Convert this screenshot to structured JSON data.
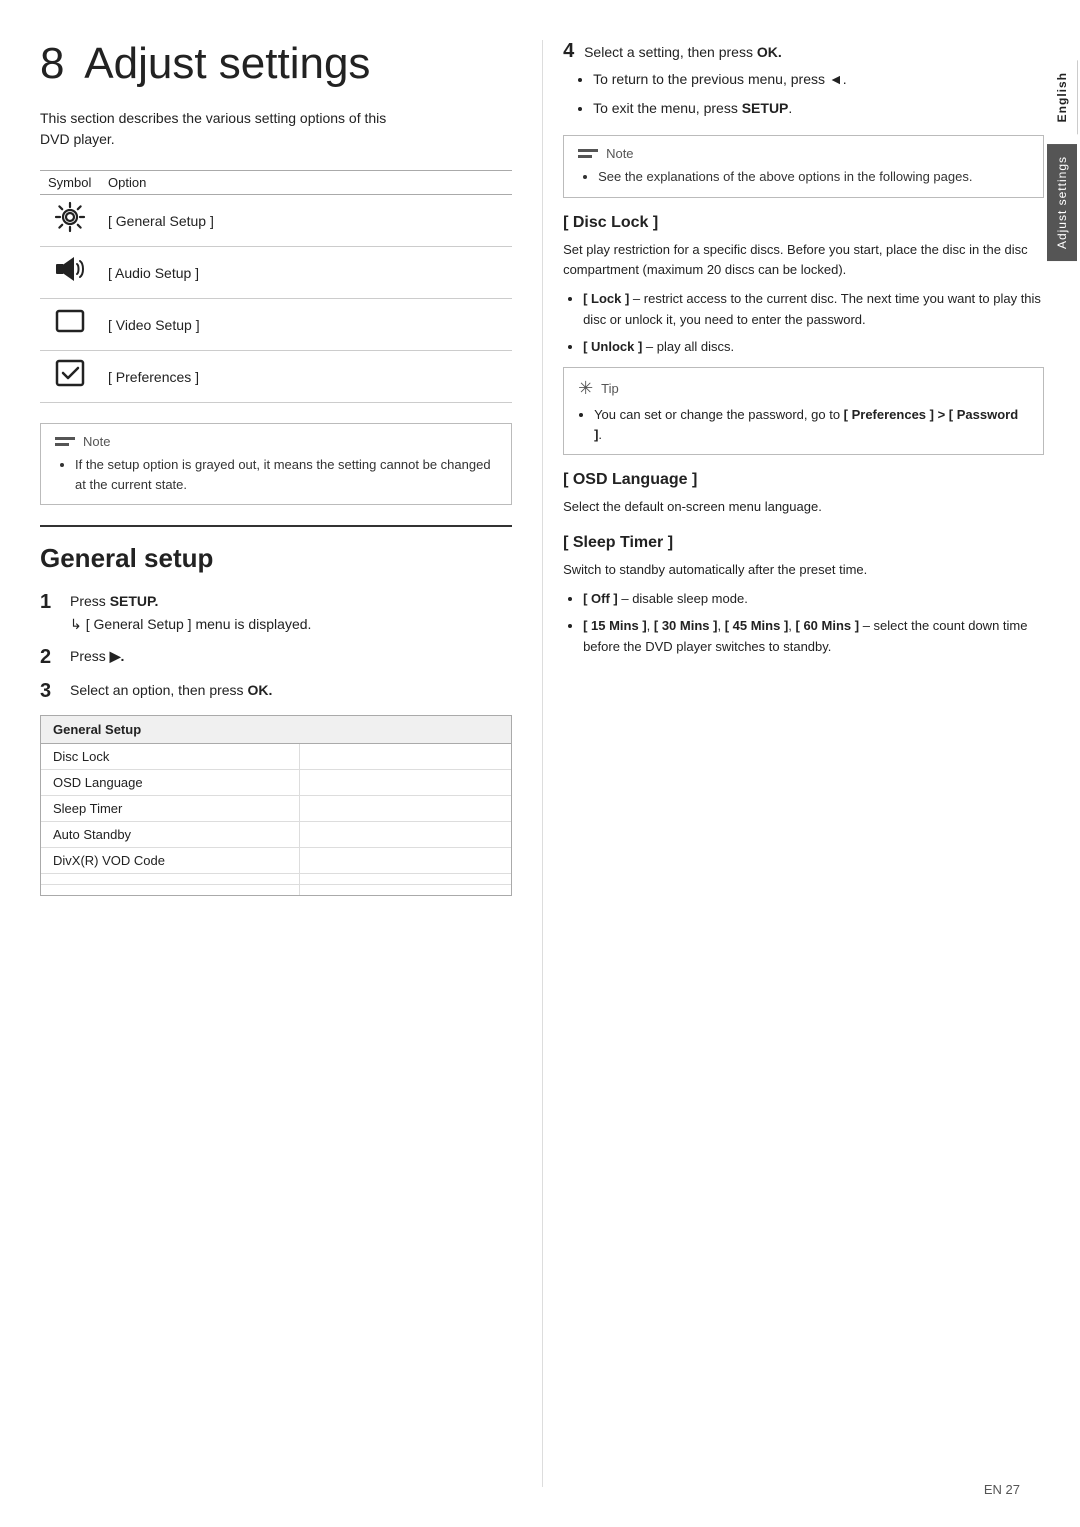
{
  "page": {
    "chapter_number": "8",
    "chapter_title": "Adjust settings",
    "intro_text": "This section describes the various setting options of this DVD player.",
    "symbol_table": {
      "col_symbol": "Symbol",
      "col_option": "Option",
      "rows": [
        {
          "symbol": "⚙",
          "option": "[ General Setup ]"
        },
        {
          "symbol": "🔊",
          "option": "[ Audio Setup ]"
        },
        {
          "symbol": "◻",
          "option": "[ Video Setup ]"
        },
        {
          "symbol": "☑",
          "option": "[ Preferences ]"
        }
      ]
    },
    "note_left": {
      "label": "Note",
      "text": "If the setup option is grayed out, it means the setting cannot be changed at the current state."
    },
    "general_setup": {
      "heading": "General setup",
      "step1_label": "1",
      "step1_text": "Press",
      "step1_kbd": "SETUP.",
      "step1_sub": "[ General Setup ] menu is displayed.",
      "step2_label": "2",
      "step2_text": "Press",
      "step2_kbd": "▶.",
      "step3_label": "3",
      "step3_text": "Select an option, then press",
      "step3_kbd": "OK.",
      "setup_table_header": "General Setup",
      "setup_table_rows": [
        {
          "left": "Disc Lock",
          "right": ""
        },
        {
          "left": "OSD Language",
          "right": ""
        },
        {
          "left": "Sleep Timer",
          "right": ""
        },
        {
          "left": "Auto Standby",
          "right": ""
        },
        {
          "left": "DivX(R) VOD Code",
          "right": ""
        },
        {
          "left": "",
          "right": ""
        },
        {
          "left": "",
          "right": ""
        }
      ]
    },
    "right_col": {
      "step4_label": "4",
      "step4_text": "Select a setting, then press",
      "step4_kbd": "OK.",
      "step4_bullets": [
        {
          "text": "To return to the previous menu, press ◄."
        },
        {
          "text": "To exit the menu, press SETUP."
        }
      ],
      "note_right": {
        "label": "Note",
        "text": "See the explanations of the above options in the following pages."
      },
      "disc_lock": {
        "title": "[ Disc Lock ]",
        "text": "Set play restriction for a specific discs. Before you start, place the disc in the disc compartment (maximum 20 discs can be locked).",
        "bullets": [
          "[ Lock ] – restrict access to the current disc. The next time you want to play this disc or unlock it, you need to enter the password.",
          "[ Unlock ] – play all discs."
        ]
      },
      "tip_box": {
        "label": "Tip",
        "text": "You can set or change the password, go to [ Preferences ] > [ Password ]."
      },
      "osd_language": {
        "title": "[ OSD Language ]",
        "text": "Select the default on-screen menu language."
      },
      "sleep_timer": {
        "title": "[ Sleep Timer ]",
        "text": "Switch to standby automatically after the preset time.",
        "bullets": [
          "[ Off ] – disable sleep mode.",
          "[ 15 Mins ], [ 30 Mins ], [ 45 Mins ], [ 60 Mins ] – select the count down time before the DVD player switches to standby."
        ]
      }
    },
    "side_tabs": {
      "english": "English",
      "adjust": "Adjust settings"
    },
    "page_number": "EN    27"
  }
}
